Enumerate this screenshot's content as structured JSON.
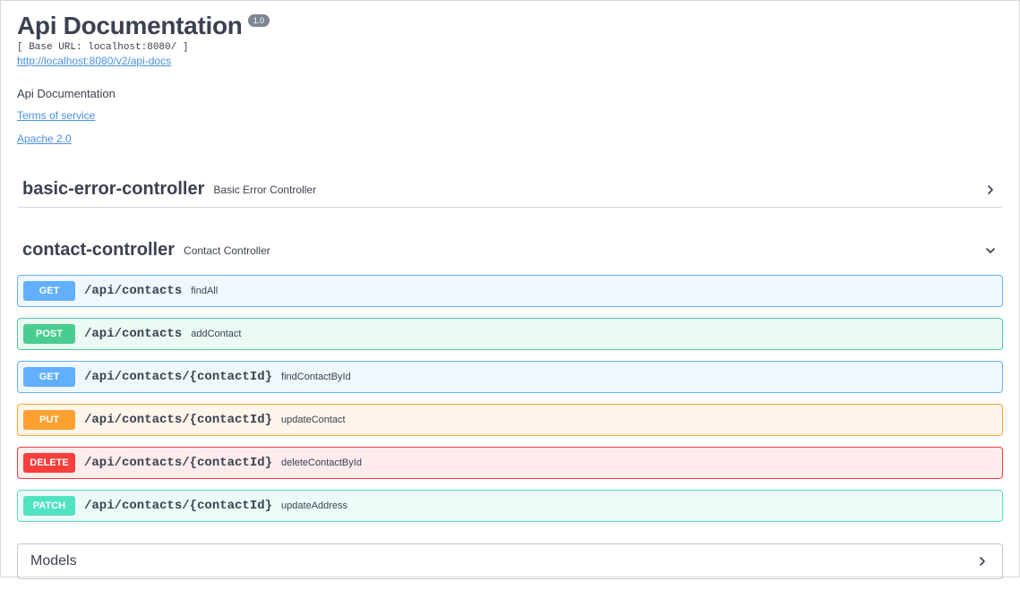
{
  "header": {
    "title": "Api Documentation",
    "version": "1.0",
    "base_url": "[ Base URL: localhost:8080/ ]",
    "api_docs_url": "http://localhost:8080/v2/api-docs",
    "description": "Api Documentation",
    "terms_label": "Terms of service",
    "license_label": "Apache 2.0"
  },
  "tags": [
    {
      "name": "basic-error-controller",
      "desc": "Basic Error Controller",
      "expanded": false
    },
    {
      "name": "contact-controller",
      "desc": "Contact Controller",
      "expanded": true
    }
  ],
  "operations": [
    {
      "method": "GET",
      "path": "/api/contacts",
      "name": "findAll"
    },
    {
      "method": "POST",
      "path": "/api/contacts",
      "name": "addContact"
    },
    {
      "method": "GET",
      "path": "/api/contacts/{contactId}",
      "name": "findContactById"
    },
    {
      "method": "PUT",
      "path": "/api/contacts/{contactId}",
      "name": "updateContact"
    },
    {
      "method": "DELETE",
      "path": "/api/contacts/{contactId}",
      "name": "deleteContactById"
    },
    {
      "method": "PATCH",
      "path": "/api/contacts/{contactId}",
      "name": "updateAddress"
    }
  ],
  "models": {
    "title": "Models"
  },
  "colors": {
    "get": "#61affe",
    "post": "#49cc90",
    "put": "#fca130",
    "delete": "#f93e3e",
    "patch": "#50e3c2",
    "link": "#4990e2"
  }
}
